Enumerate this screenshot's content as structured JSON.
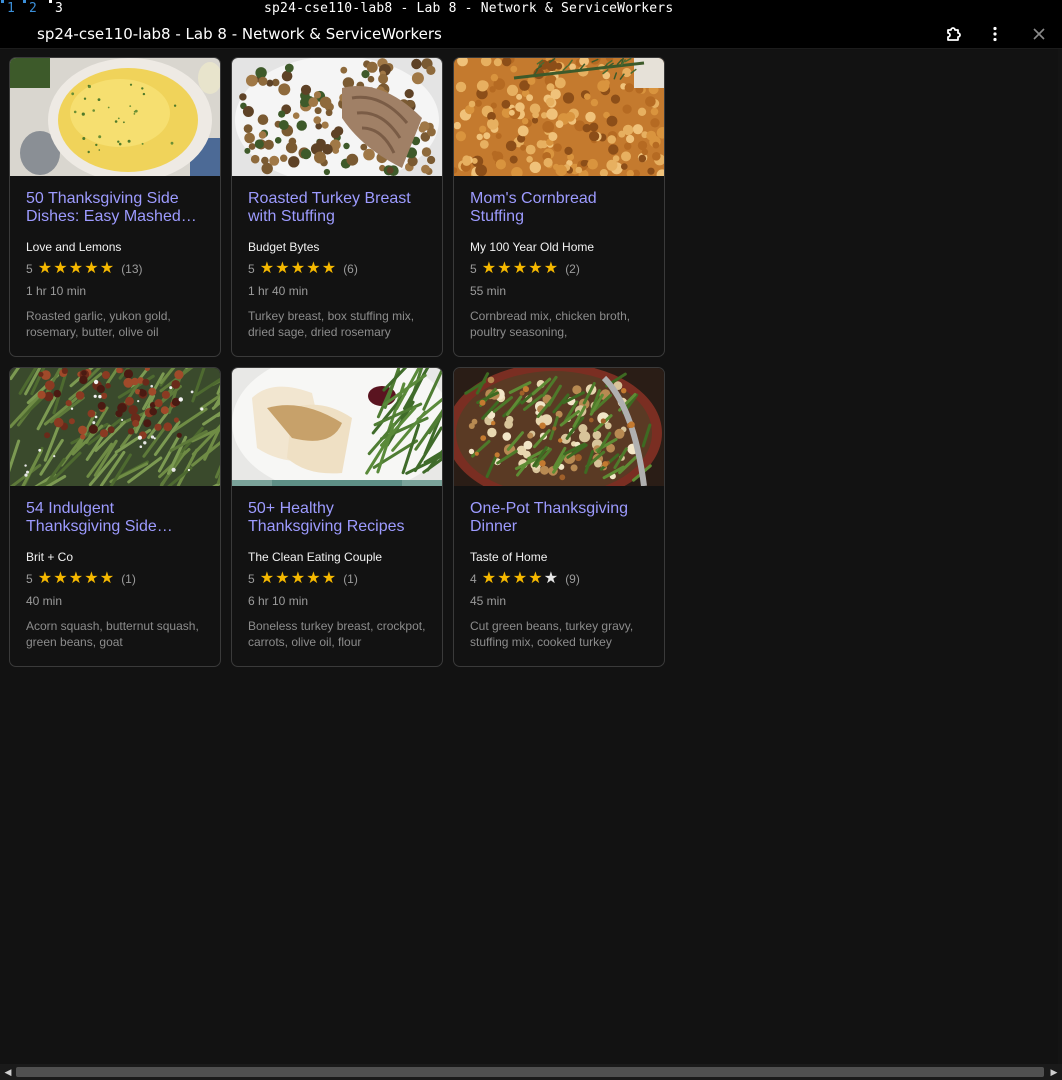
{
  "wm": {
    "workspaces": [
      "1",
      "2",
      "3"
    ],
    "title": "sp24-cse110-lab8 - Lab 8 - Network & ServiceWorkers"
  },
  "app": {
    "title": "sp24-cse110-lab8 - Lab 8 - Network & ServiceWorkers",
    "icons": [
      "extension-icon",
      "kebab-menu-icon",
      "close-icon"
    ]
  },
  "colors": {
    "accent_link": "#9d9bff",
    "star": "#f5b800",
    "background": "#121212"
  },
  "recipes": [
    {
      "title": "50 Thanksgiving Side Dishes: Easy Mashed…",
      "org": "Love and Lemons",
      "rating": "5",
      "stars_filled": 5,
      "reviews": "(13)",
      "time": "1 hr 10 min",
      "ingredients": "Roasted garlic, yukon gold, rosemary, butter, olive oil",
      "image": "mashed-potatoes"
    },
    {
      "title": "Roasted Turkey Breast with Stuffing",
      "org": "Budget Bytes",
      "rating": "5",
      "stars_filled": 5,
      "reviews": "(6)",
      "time": "1 hr 40 min",
      "ingredients": "Turkey breast, box stuffing mix, dried sage, dried rosemary",
      "image": "turkey-stuffing"
    },
    {
      "title": "Mom's Cornbread Stuffing",
      "org": "My 100 Year Old Home",
      "rating": "5",
      "stars_filled": 5,
      "reviews": "(2)",
      "time": "55 min",
      "ingredients": "Cornbread mix, chicken broth, poultry seasoning,",
      "image": "cornbread-stuffing"
    },
    {
      "title": "54 Indulgent Thanksgiving Side…",
      "org": "Brit + Co",
      "rating": "5",
      "stars_filled": 5,
      "reviews": "(1)",
      "time": "40 min",
      "ingredients": "Acorn squash, butternut squash, green beans, goat",
      "image": "green-beans-pecans"
    },
    {
      "title": "50+ Healthy Thanksgiving Recipes",
      "org": "The Clean Eating Couple",
      "rating": "5",
      "stars_filled": 5,
      "reviews": "(1)",
      "time": "6 hr 10 min",
      "ingredients": "Boneless turkey breast, crockpot, carrots, olive oil, flour",
      "image": "turkey-gravy-plate"
    },
    {
      "title": "One-Pot Thanksgiving Dinner",
      "org": "Taste of Home",
      "rating": "4",
      "stars_filled": 4,
      "reviews": "(9)",
      "time": "45 min",
      "ingredients": "Cut green beans, turkey gravy, stuffing mix, cooked turkey",
      "image": "one-pot-dinner"
    }
  ]
}
